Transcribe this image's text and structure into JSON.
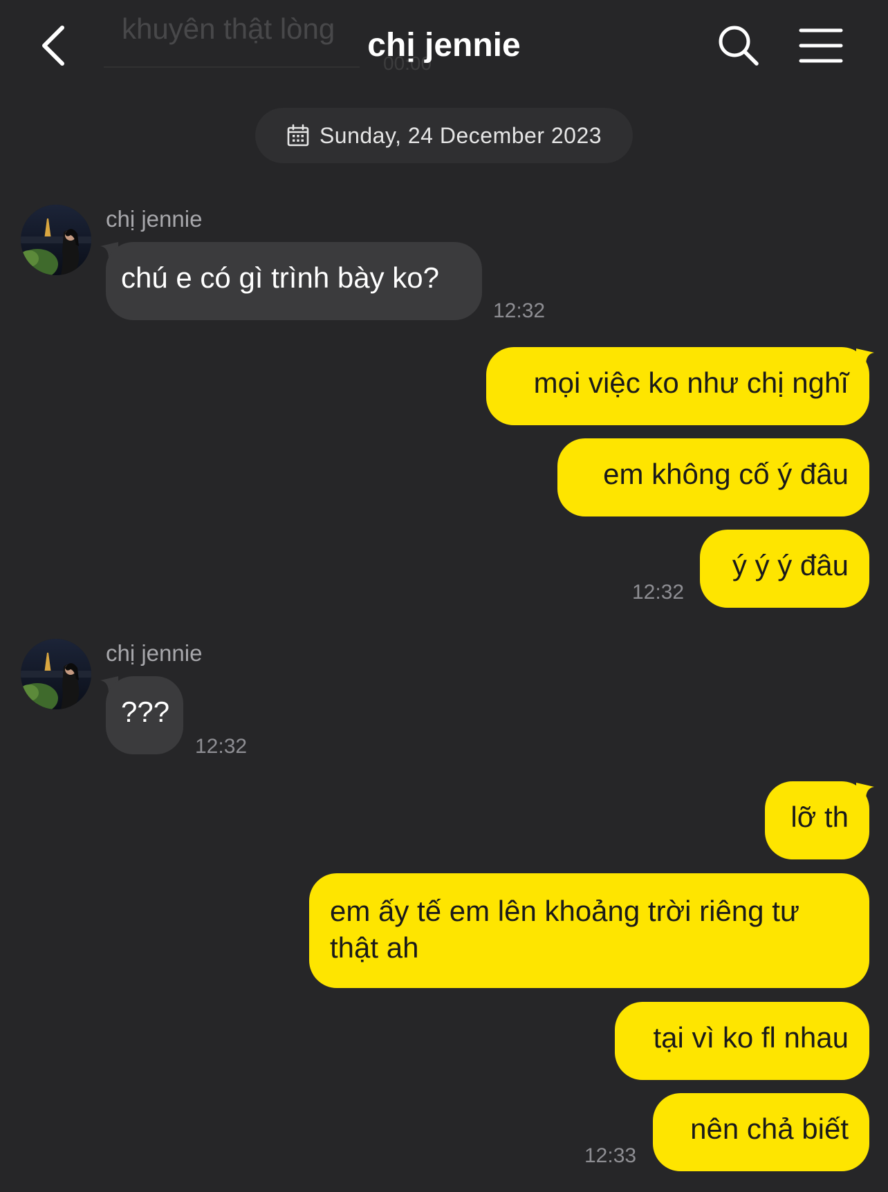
{
  "header": {
    "title": "chị jennie",
    "ghost_text": "khuyên thật lòng",
    "ghost_subtext": "00:00",
    "icons": {
      "back": "chevron-left-icon",
      "search": "magnifier-icon",
      "menu": "hamburger-icon"
    }
  },
  "date_divider": {
    "icon": "calendar-icon",
    "label": "Sunday, 24 December 2023"
  },
  "messages": [
    {
      "from": "chị jennie",
      "text": "chú e có gì trình bày ko?",
      "time": "12:32"
    },
    {
      "from": "me",
      "text": "mọi việc ko như chị nghĩ"
    },
    {
      "from": "me",
      "text": "em không cố ý đâu"
    },
    {
      "from": "me",
      "text": "ý ý ý đâu",
      "time": "12:32"
    },
    {
      "from": "chị jennie",
      "text": "???",
      "time": "12:32"
    },
    {
      "from": "me",
      "text": "lỡ th"
    },
    {
      "from": "me",
      "text": "em ấy tế em lên khoảng trời riêng tư thật ah"
    },
    {
      "from": "me",
      "text": "tại vì ko fl nhau"
    },
    {
      "from": "me",
      "text": "nên chả biết",
      "time": "12:33"
    }
  ],
  "colors": {
    "background": "#262628",
    "outgoing_bubble": "#fee500",
    "incoming_bubble": "#3b3b3d",
    "timestamp": "#8e8e93",
    "sender_name": "#a8a8ac"
  }
}
